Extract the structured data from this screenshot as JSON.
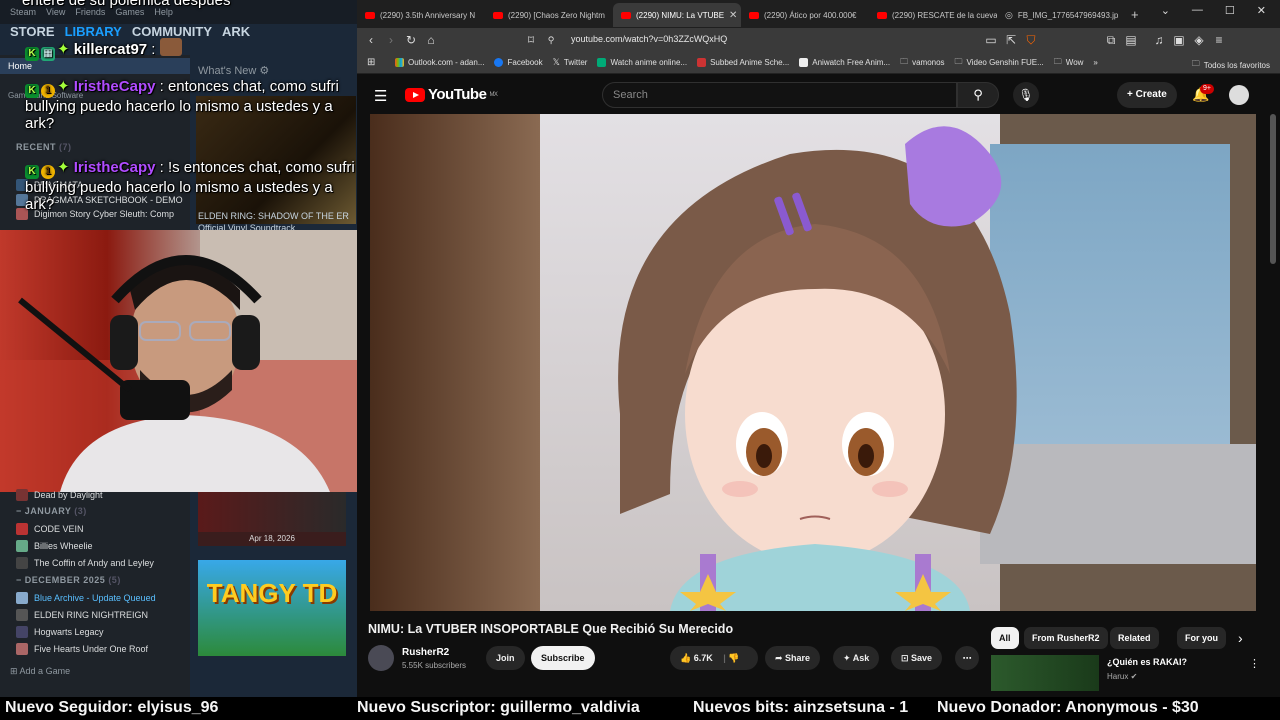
{
  "steam": {
    "menu": [
      "Steam",
      "View",
      "Friends",
      "Games",
      "Help"
    ],
    "tabs": [
      "STORE",
      "LIBRARY",
      "COMMUNITY",
      "ARK"
    ],
    "home": "Home",
    "whats_new": "What's New",
    "games_software": "Games and Software",
    "recent_head": "RECENT",
    "recent_count": "(7)",
    "recent_items": [
      "PRAGMATA",
      "PRAGMATA SKETCHBOOK - DEMO",
      "Digimon Story Cyber Sleuth: Comp"
    ],
    "featured_title": "ELDEN RING: SHADOW OF THE ER",
    "featured_sub": "Official Vinyl Soundtrack",
    "dead_by_daylight": "Dead by Daylight",
    "january_head": "JANUARY",
    "january_count": "(3)",
    "january_items": [
      "CODE VEIN",
      "Billies Wheelie",
      "The Coffin of Andy and Leyley"
    ],
    "december_head": "DECEMBER 2025",
    "december_count": "(5)",
    "december_items": [
      "Blue Archive - Update Queued",
      "ELDEN RING NIGHTREIGN",
      "Hogwarts Legacy",
      "Five Hearts Under One Roof"
    ],
    "add_game": "Add a Game",
    "card_date": "Apr 18, 2026",
    "tangy_logo": "TANGY TD"
  },
  "chat": {
    "prev_line": "entere de su polemica despues",
    "messages": [
      {
        "user": "killercat97",
        "text": " :"
      },
      {
        "user": "IristheCapy",
        "text": " : entonces chat, como sufri bullying puedo hacerlo lo mismo a ustedes y a ark?"
      },
      {
        "user": "IristheCapy",
        "text": " : !s entonces chat, como sufri bullying puedo hacerlo lo mismo a ustedes y a ark?"
      }
    ]
  },
  "browser": {
    "tabs": [
      "(2290) 3.5th Anniversary N",
      "(2290) [Chaos Zero Nightm",
      "(2290) NIMU: La VTUBE",
      "(2290) Ático por 400.000€",
      "(2290) RESCATE de la cueva",
      "FB_IMG_1776547969493.jp"
    ],
    "url": "youtube.com/watch?v=0h3ZZcWQxHQ",
    "bookmarks": [
      "Outlook.com - adan...",
      "Facebook",
      "Twitter",
      "Watch anime online...",
      "Subbed Anime Sche...",
      "Aniwatch Free Anim...",
      "vamonos",
      "Video Genshin FUE...",
      "Wow"
    ],
    "bookmarks_right": "Todos los favoritos"
  },
  "youtube": {
    "logo": "YouTube",
    "region": "MX",
    "search_placeholder": "Search",
    "create": "Create",
    "notifications": "9+",
    "video_title": "NIMU: La VTUBER INSOPORTABLE Que Recibió Su Merecido",
    "channel": "RusherR2",
    "subscribers": "5.55K subscribers",
    "join": "Join",
    "subscribe": "Subscribe",
    "likes": "6.7K",
    "share": "Share",
    "ask": "Ask",
    "save": "Save",
    "chips": [
      "All",
      "From RusherR2",
      "Related",
      "For you"
    ],
    "rec_title": "¿Quién es RAKAI?",
    "rec_channel": "Harux"
  },
  "ticker": {
    "follower": "Nuevo Seguidor: elyisus_96",
    "subscriber": "Nuevo Suscriptor: guillermo_valdivia",
    "bits": "Nuevos bits: ainzsetsuna - 1",
    "donor": "Nuevo Donador: Anonymous - $30"
  }
}
